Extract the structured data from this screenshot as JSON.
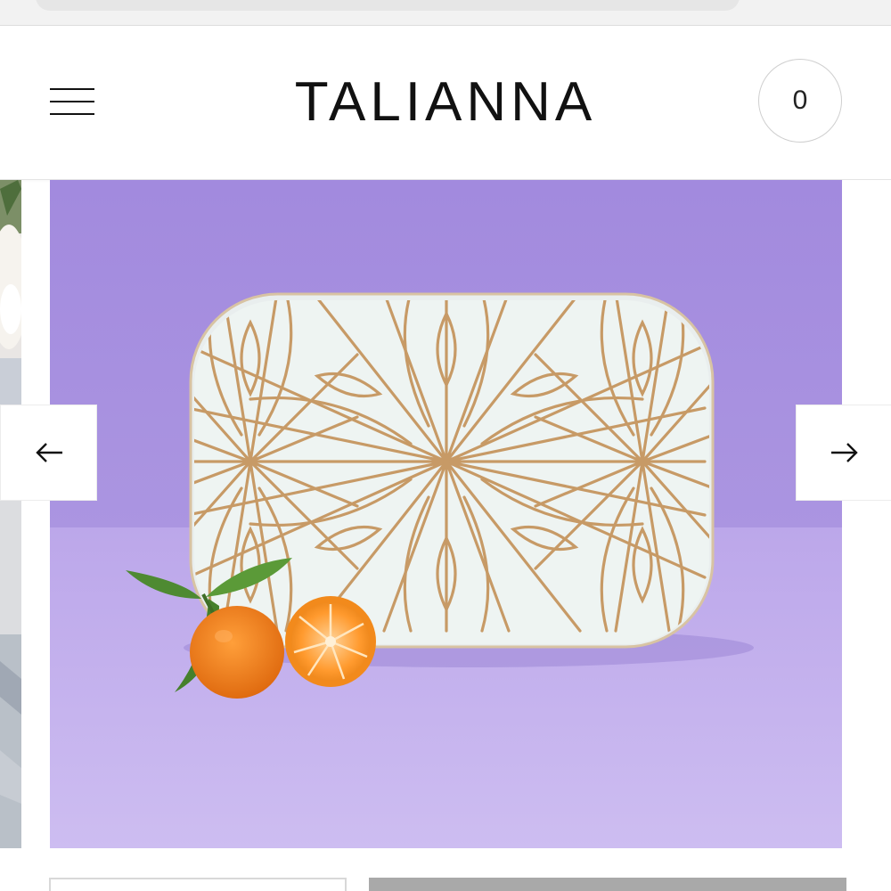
{
  "header": {
    "brand": "TALIANNA",
    "cart_count": "0"
  },
  "icons": {
    "menu": "hamburger-menu-icon",
    "prev": "arrow-left-icon",
    "next": "arrow-right-icon"
  },
  "colors": {
    "backdrop_purple": "#a992df",
    "tabletop_lavender": "#c5b2ed",
    "tray_white": "#eef4f2",
    "tray_gold": "#c79a66",
    "orange": "#f27d17"
  }
}
